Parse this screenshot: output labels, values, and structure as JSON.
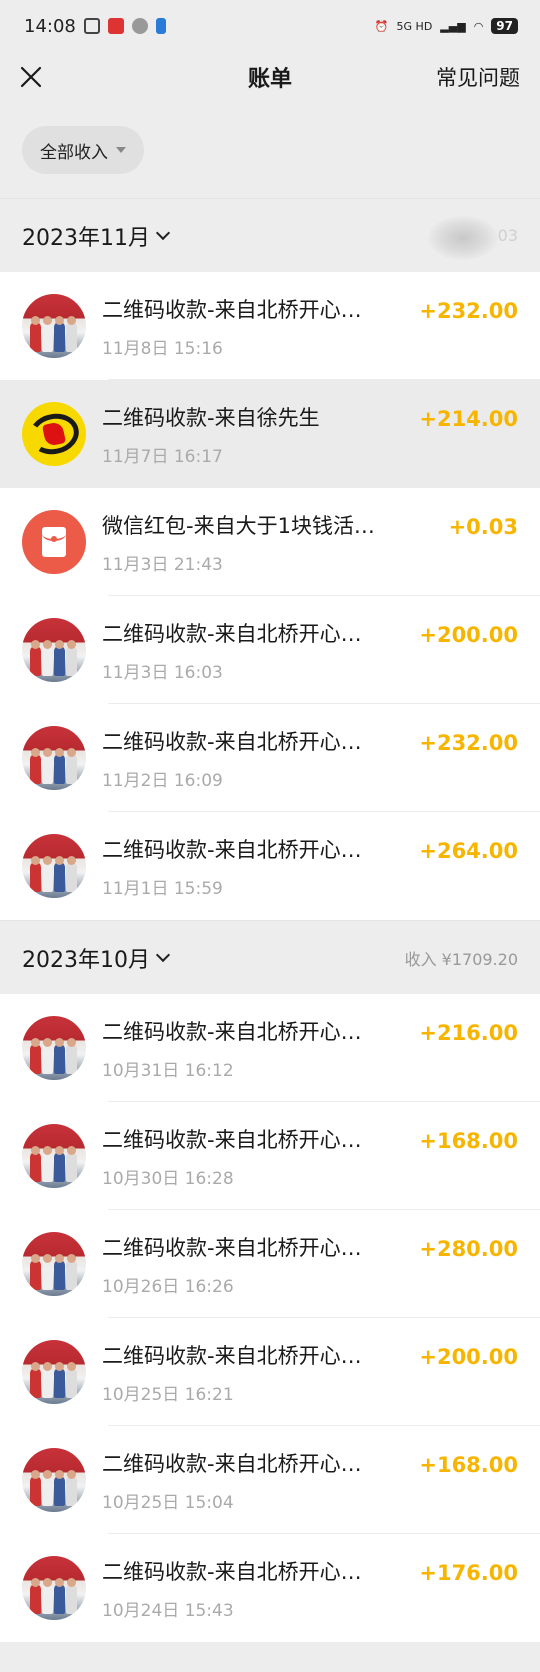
{
  "status": {
    "time": "14:08",
    "network": "5G HD",
    "battery": "97"
  },
  "nav": {
    "title": "账单",
    "faq": "常见问题"
  },
  "filter": {
    "label": "全部收入"
  },
  "months": [
    {
      "label": "2023年11月",
      "summary": "",
      "summary_tail": "03",
      "items": [
        {
          "title": "二维码收款-来自北桥开心…",
          "time": "11月8日 15:16",
          "amount": "+232.00",
          "avatar": "photo"
        },
        {
          "title": "二维码收款-来自徐先生",
          "time": "11月7日 16:17",
          "amount": "+214.00",
          "avatar": "logo"
        },
        {
          "title": "微信红包-来自大于1块钱活…",
          "time": "11月3日 21:43",
          "amount": "+0.03",
          "avatar": "redpacket"
        },
        {
          "title": "二维码收款-来自北桥开心…",
          "time": "11月3日 16:03",
          "amount": "+200.00",
          "avatar": "photo"
        },
        {
          "title": "二维码收款-来自北桥开心…",
          "time": "11月2日 16:09",
          "amount": "+232.00",
          "avatar": "photo"
        },
        {
          "title": "二维码收款-来自北桥开心…",
          "time": "11月1日 15:59",
          "amount": "+264.00",
          "avatar": "photo"
        }
      ]
    },
    {
      "label": "2023年10月",
      "summary": "收入 ¥1709.20",
      "items": [
        {
          "title": "二维码收款-来自北桥开心…",
          "time": "10月31日 16:12",
          "amount": "+216.00",
          "avatar": "photo"
        },
        {
          "title": "二维码收款-来自北桥开心…",
          "time": "10月30日 16:28",
          "amount": "+168.00",
          "avatar": "photo"
        },
        {
          "title": "二维码收款-来自北桥开心…",
          "time": "10月26日 16:26",
          "amount": "+280.00",
          "avatar": "photo"
        },
        {
          "title": "二维码收款-来自北桥开心…",
          "time": "10月25日 16:21",
          "amount": "+200.00",
          "avatar": "photo"
        },
        {
          "title": "二维码收款-来自北桥开心…",
          "time": "10月25日 15:04",
          "amount": "+168.00",
          "avatar": "photo"
        },
        {
          "title": "二维码收款-来自北桥开心…",
          "time": "10月24日 15:43",
          "amount": "+176.00",
          "avatar": "photo"
        }
      ]
    }
  ],
  "colors": {
    "amount": "#f7b500",
    "background": "#ededed",
    "secondary_text": "#aaaaaa"
  }
}
